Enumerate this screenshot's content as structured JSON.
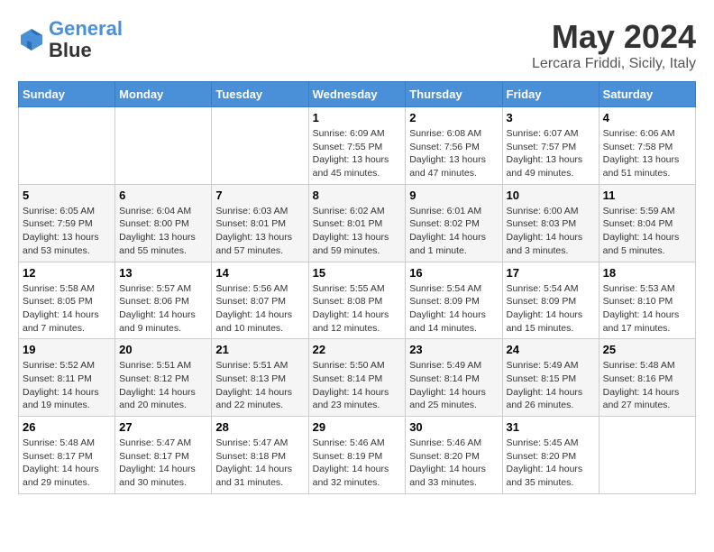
{
  "header": {
    "logo_line1": "General",
    "logo_line2": "Blue",
    "title": "May 2024",
    "subtitle": "Lercara Friddi, Sicily, Italy"
  },
  "weekdays": [
    "Sunday",
    "Monday",
    "Tuesday",
    "Wednesday",
    "Thursday",
    "Friday",
    "Saturday"
  ],
  "weeks": [
    [
      {
        "day": "",
        "info": ""
      },
      {
        "day": "",
        "info": ""
      },
      {
        "day": "",
        "info": ""
      },
      {
        "day": "1",
        "info": "Sunrise: 6:09 AM\nSunset: 7:55 PM\nDaylight: 13 hours\nand 45 minutes."
      },
      {
        "day": "2",
        "info": "Sunrise: 6:08 AM\nSunset: 7:56 PM\nDaylight: 13 hours\nand 47 minutes."
      },
      {
        "day": "3",
        "info": "Sunrise: 6:07 AM\nSunset: 7:57 PM\nDaylight: 13 hours\nand 49 minutes."
      },
      {
        "day": "4",
        "info": "Sunrise: 6:06 AM\nSunset: 7:58 PM\nDaylight: 13 hours\nand 51 minutes."
      }
    ],
    [
      {
        "day": "5",
        "info": "Sunrise: 6:05 AM\nSunset: 7:59 PM\nDaylight: 13 hours\nand 53 minutes."
      },
      {
        "day": "6",
        "info": "Sunrise: 6:04 AM\nSunset: 8:00 PM\nDaylight: 13 hours\nand 55 minutes."
      },
      {
        "day": "7",
        "info": "Sunrise: 6:03 AM\nSunset: 8:01 PM\nDaylight: 13 hours\nand 57 minutes."
      },
      {
        "day": "8",
        "info": "Sunrise: 6:02 AM\nSunset: 8:01 PM\nDaylight: 13 hours\nand 59 minutes."
      },
      {
        "day": "9",
        "info": "Sunrise: 6:01 AM\nSunset: 8:02 PM\nDaylight: 14 hours\nand 1 minute."
      },
      {
        "day": "10",
        "info": "Sunrise: 6:00 AM\nSunset: 8:03 PM\nDaylight: 14 hours\nand 3 minutes."
      },
      {
        "day": "11",
        "info": "Sunrise: 5:59 AM\nSunset: 8:04 PM\nDaylight: 14 hours\nand 5 minutes."
      }
    ],
    [
      {
        "day": "12",
        "info": "Sunrise: 5:58 AM\nSunset: 8:05 PM\nDaylight: 14 hours\nand 7 minutes."
      },
      {
        "day": "13",
        "info": "Sunrise: 5:57 AM\nSunset: 8:06 PM\nDaylight: 14 hours\nand 9 minutes."
      },
      {
        "day": "14",
        "info": "Sunrise: 5:56 AM\nSunset: 8:07 PM\nDaylight: 14 hours\nand 10 minutes."
      },
      {
        "day": "15",
        "info": "Sunrise: 5:55 AM\nSunset: 8:08 PM\nDaylight: 14 hours\nand 12 minutes."
      },
      {
        "day": "16",
        "info": "Sunrise: 5:54 AM\nSunset: 8:09 PM\nDaylight: 14 hours\nand 14 minutes."
      },
      {
        "day": "17",
        "info": "Sunrise: 5:54 AM\nSunset: 8:09 PM\nDaylight: 14 hours\nand 15 minutes."
      },
      {
        "day": "18",
        "info": "Sunrise: 5:53 AM\nSunset: 8:10 PM\nDaylight: 14 hours\nand 17 minutes."
      }
    ],
    [
      {
        "day": "19",
        "info": "Sunrise: 5:52 AM\nSunset: 8:11 PM\nDaylight: 14 hours\nand 19 minutes."
      },
      {
        "day": "20",
        "info": "Sunrise: 5:51 AM\nSunset: 8:12 PM\nDaylight: 14 hours\nand 20 minutes."
      },
      {
        "day": "21",
        "info": "Sunrise: 5:51 AM\nSunset: 8:13 PM\nDaylight: 14 hours\nand 22 minutes."
      },
      {
        "day": "22",
        "info": "Sunrise: 5:50 AM\nSunset: 8:14 PM\nDaylight: 14 hours\nand 23 minutes."
      },
      {
        "day": "23",
        "info": "Sunrise: 5:49 AM\nSunset: 8:14 PM\nDaylight: 14 hours\nand 25 minutes."
      },
      {
        "day": "24",
        "info": "Sunrise: 5:49 AM\nSunset: 8:15 PM\nDaylight: 14 hours\nand 26 minutes."
      },
      {
        "day": "25",
        "info": "Sunrise: 5:48 AM\nSunset: 8:16 PM\nDaylight: 14 hours\nand 27 minutes."
      }
    ],
    [
      {
        "day": "26",
        "info": "Sunrise: 5:48 AM\nSunset: 8:17 PM\nDaylight: 14 hours\nand 29 minutes."
      },
      {
        "day": "27",
        "info": "Sunrise: 5:47 AM\nSunset: 8:17 PM\nDaylight: 14 hours\nand 30 minutes."
      },
      {
        "day": "28",
        "info": "Sunrise: 5:47 AM\nSunset: 8:18 PM\nDaylight: 14 hours\nand 31 minutes."
      },
      {
        "day": "29",
        "info": "Sunrise: 5:46 AM\nSunset: 8:19 PM\nDaylight: 14 hours\nand 32 minutes."
      },
      {
        "day": "30",
        "info": "Sunrise: 5:46 AM\nSunset: 8:20 PM\nDaylight: 14 hours\nand 33 minutes."
      },
      {
        "day": "31",
        "info": "Sunrise: 5:45 AM\nSunset: 8:20 PM\nDaylight: 14 hours\nand 35 minutes."
      },
      {
        "day": "",
        "info": ""
      }
    ]
  ]
}
